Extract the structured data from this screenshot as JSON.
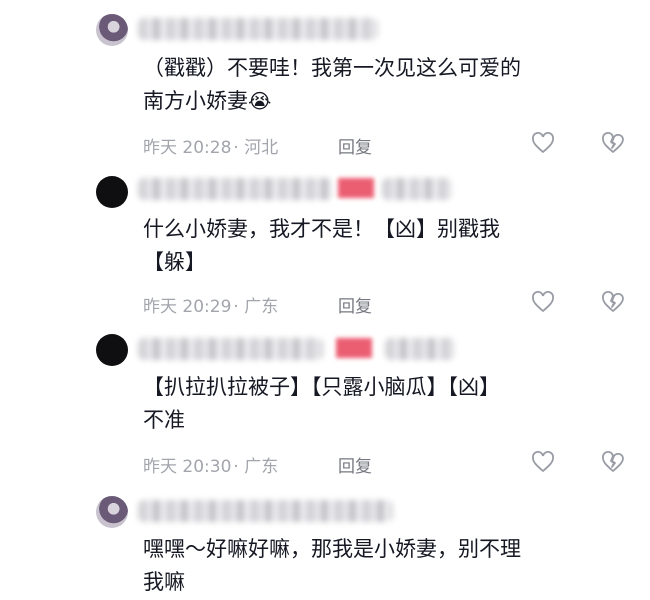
{
  "comments": [
    {
      "text_line1": "（戳戳）不要哇！我第一次见这么可爱的",
      "text_line2": "南方小娇妻",
      "emoji": "😭",
      "time": "昨天 20:28",
      "location": "· 河北",
      "reply": "回复"
    },
    {
      "text_line1": "什么小娇妻，我才不是！【凶】别戳我",
      "text_line2": "【躲】",
      "time": "昨天 20:29",
      "location": "· 广东",
      "reply": "回复"
    },
    {
      "text_line1": "【扒拉扒拉被子】【只露小脑瓜】【凶】",
      "text_line2": "不准",
      "time": "昨天 20:30",
      "location": "· 广东",
      "reply": "回复"
    },
    {
      "text_line1": "嘿嘿～好嘛好嘛，那我是小娇妻，别不理",
      "text_line2": "我嘛"
    }
  ],
  "icons": {
    "like": "heart-outline-icon",
    "dislike": "broken-heart-icon"
  }
}
